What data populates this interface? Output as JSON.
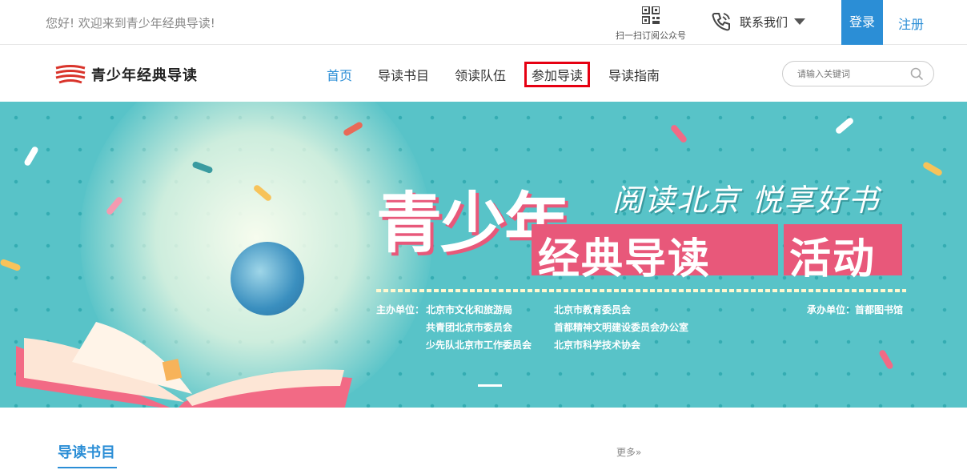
{
  "topbar": {
    "welcome": "您好! 欢迎来到青少年经典导读!",
    "qr_label": "扫一扫订阅公众号",
    "contact_label": "联系我们",
    "login": "登录",
    "register": "注册"
  },
  "header": {
    "logo_text": "青少年经典导读",
    "nav": [
      "首页",
      "导读书目",
      "领读队伍",
      "参加导读",
      "导读指南"
    ],
    "active_index": 0,
    "highlighted_index": 3,
    "search_placeholder": "请输入关键词"
  },
  "banner": {
    "title_main": "青少年",
    "slogan": "阅读北京 悦享好书",
    "title_band": "经典导读",
    "title_band_2": "活动",
    "host_label": "主办单位：",
    "hosts": [
      "北京市文化和旅游局",
      "北京市教育委员会",
      "共青团北京市委员会",
      "首都精神文明建设委员会办公室",
      "少先队北京市工作委员会",
      "北京市科学技术协会"
    ],
    "organizer": "承办单位：首都图书馆"
  },
  "section": {
    "title": "导读书目",
    "more": "更多»"
  },
  "colors": {
    "accent": "#2b8ed6",
    "highlight_box": "#e60012",
    "banner_bg": "#58c3c8",
    "banner_pink": "#e8587a"
  },
  "icons": {
    "qr": "qr-code-icon",
    "phone": "phone-icon",
    "search": "search-icon",
    "logo": "book-logo-icon"
  }
}
